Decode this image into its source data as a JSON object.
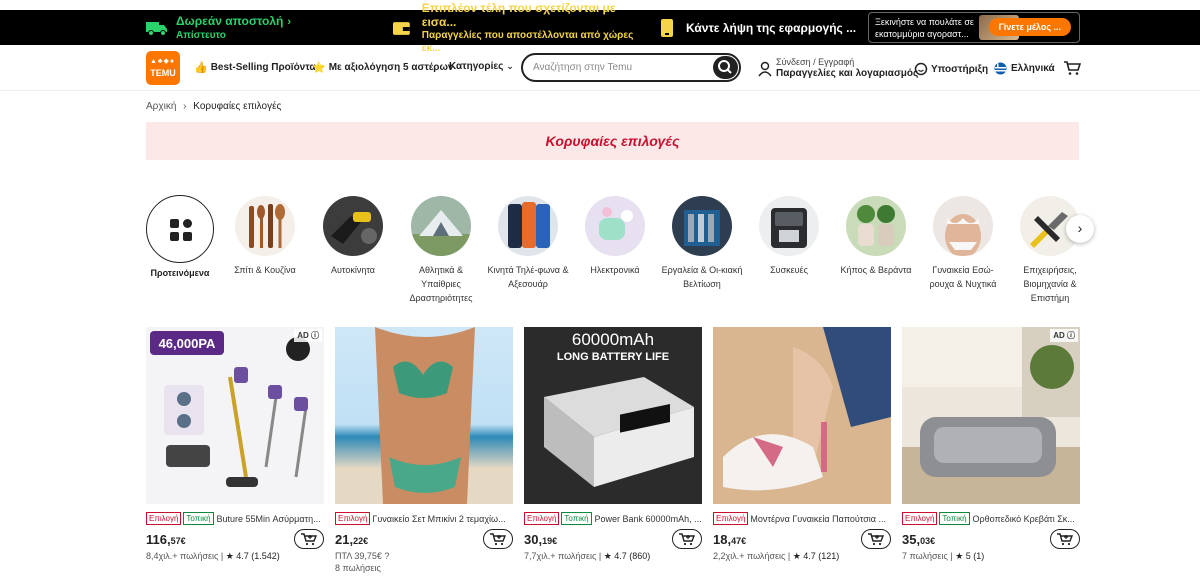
{
  "promo": {
    "free_shipping_title": "Δωρεάν αποστολή",
    "free_shipping_sub": "Απίστευτο",
    "fees_title": "Επιπλέον τέλη που σχετίζονται με εισα...",
    "fees_sub": "Παραγγελίες που αποστέλλονται από χώρες εκ...",
    "app_title": "Κάντε λήψη της εφαρμογής ...",
    "seller_text": "Ξεκινήστε να πουλάτε σε εκατομμύρια αγοραστ...",
    "seller_button": "Γίνετε μέλος ..."
  },
  "header": {
    "logo_text": "TEMU",
    "best_selling": "Best-Selling Προϊόντα",
    "five_star": "Με αξιολόγηση 5 αστέρων",
    "categories": "Κατηγορίες",
    "search_placeholder": "Αναζήτηση στην Temu",
    "account_line1": "Σύνδεση / Εγγραφή",
    "account_line2": "Παραγγελίες και λογαριασμός",
    "support": "Υποστήριξη",
    "language": "Ελληνικά"
  },
  "breadcrumb": {
    "home": "Αρχική",
    "separator": "›",
    "current": "Κορυφαίες επιλογές"
  },
  "banner": {
    "title": "Κορυφαίες επιλογές"
  },
  "categories": [
    {
      "label": "Προτεινόμενα"
    },
    {
      "label": "Σπίτι & Κουζίνα"
    },
    {
      "label": "Αυτοκίνητα"
    },
    {
      "label": "Αθλητικά & Υπαίθριες Δραστηριότητες"
    },
    {
      "label": "Κινητά Τηλέ-φωνα & Αξεσουάρ"
    },
    {
      "label": "Ηλεκτρονικά"
    },
    {
      "label": "Εργαλεία & Οι-κιακή Βελτίωση"
    },
    {
      "label": "Συσκευές"
    },
    {
      "label": "Κήπος & Βεράντα"
    },
    {
      "label": "Γυναικεία Εσώ-ρουχα & Νυχτικά"
    },
    {
      "label": "Επιχειρήσεις, Βιομηχανία & Επιστήμη"
    }
  ],
  "tags": {
    "choice": "Επιλογή",
    "local": "Τοπική"
  },
  "products": [
    {
      "name": "Buture 55Min Ασύρματη...",
      "price_int": "116,",
      "price_dec": "57€",
      "sold": "8,4χιλ.+ πωλήσεις",
      "rating": "★ 4.7 (1.542)",
      "ad": "AD ⓘ",
      "image_text": "46,000PA"
    },
    {
      "name": "Γυναικείο Σετ Μπικίνι 2 τεμαχίω...",
      "price_int": "21,",
      "price_dec": "22€",
      "old_price": "ΠΤΛ 39,75€ ?",
      "sold": "8 πωλήσεις"
    },
    {
      "name": "Power Bank 60000mAh, ...",
      "price_int": "30,",
      "price_dec": "19€",
      "sold": "7,7χιλ.+ πωλήσεις",
      "rating": "★ 4.7 (860)",
      "image_text": "60000mAh",
      "image_sub": "LONG BATTERY LIFE"
    },
    {
      "name": "Μοντέρνα Γυναικεία Παπούτσια ...",
      "price_int": "18,",
      "price_dec": "47€",
      "sold": "2,2χιλ.+ πωλήσεις",
      "rating": "★ 4.7 (121)"
    },
    {
      "name": "Ορθοπεδικό Κρεβάτι Σκ...",
      "price_int": "35,",
      "price_dec": "03€",
      "sold": "7 πωλήσεις",
      "rating": "★ 5 (1)",
      "ad": "AD ⓘ"
    }
  ]
}
